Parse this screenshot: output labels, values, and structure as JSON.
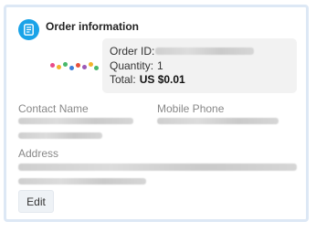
{
  "header": {
    "title": "Order information",
    "icon": "document-icon",
    "icon_color": "#1aa3e8"
  },
  "order": {
    "id_label": "Order ID:",
    "quantity_label": "Quantity:",
    "quantity_value": "1",
    "total_label": "Total:",
    "total_value": "US $0.01"
  },
  "contact": {
    "name_label": "Contact Name",
    "phone_label": "Mobile Phone",
    "address_label": "Address"
  },
  "actions": {
    "edit_label": "Edit"
  }
}
